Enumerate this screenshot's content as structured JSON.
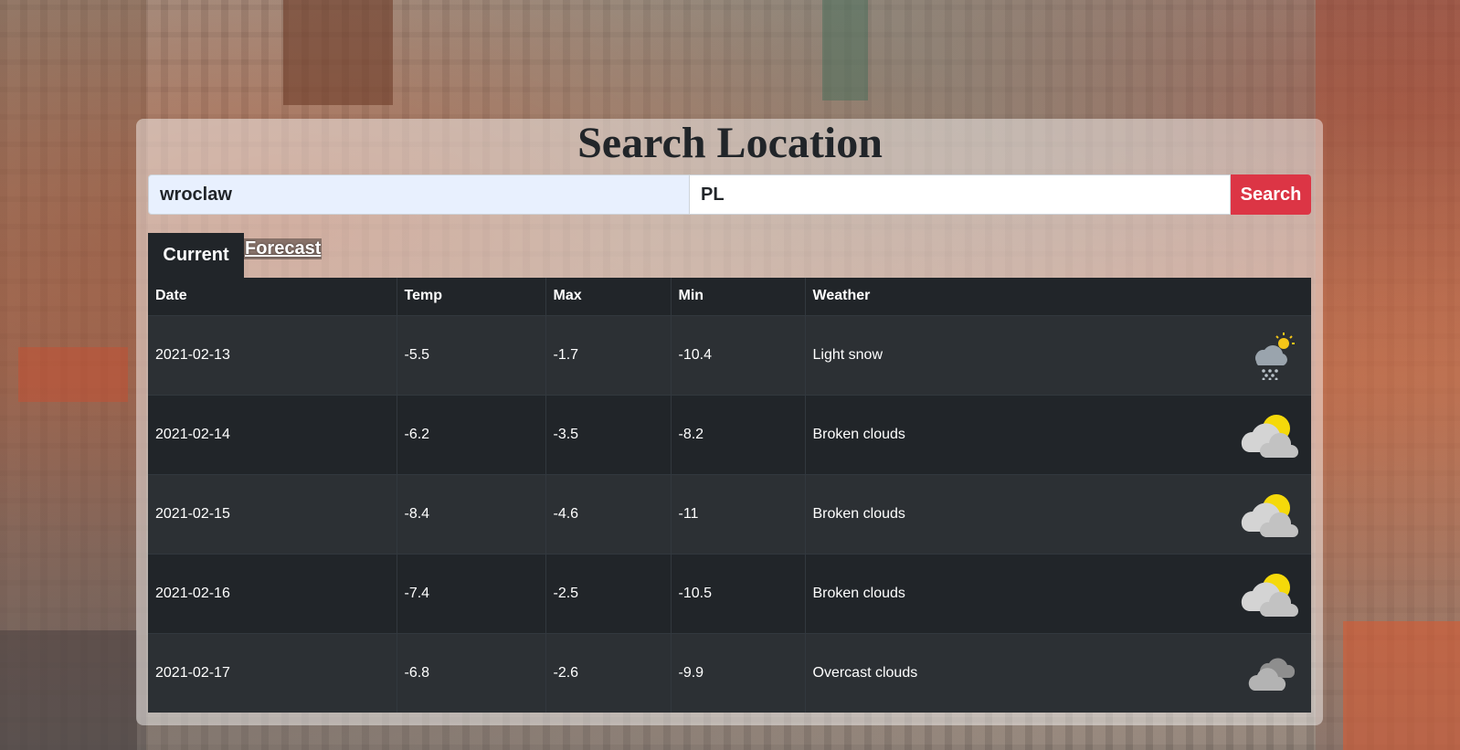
{
  "header": {
    "title": "Search Location"
  },
  "search": {
    "city_value": "wroclaw",
    "country_value": "PL",
    "button_label": "Search"
  },
  "tabs": [
    {
      "label": "Current",
      "active": true
    },
    {
      "label": "Forecast",
      "active": false
    }
  ],
  "table": {
    "columns": [
      "Date",
      "Temp",
      "Max",
      "Min",
      "Weather"
    ],
    "rows": [
      {
        "date": "2021-02-13",
        "temp": "-5.5",
        "max": "-1.7",
        "min": "-10.4",
        "weather": "Light snow",
        "icon": "light-snow-icon"
      },
      {
        "date": "2021-02-14",
        "temp": "-6.2",
        "max": "-3.5",
        "min": "-8.2",
        "weather": "Broken clouds",
        "icon": "broken-clouds-icon"
      },
      {
        "date": "2021-02-15",
        "temp": "-8.4",
        "max": "-4.6",
        "min": "-11",
        "weather": "Broken clouds",
        "icon": "broken-clouds-icon"
      },
      {
        "date": "2021-02-16",
        "temp": "-7.4",
        "max": "-2.5",
        "min": "-10.5",
        "weather": "Broken clouds",
        "icon": "broken-clouds-icon"
      },
      {
        "date": "2021-02-17",
        "temp": "-6.8",
        "max": "-2.6",
        "min": "-9.9",
        "weather": "Overcast clouds",
        "icon": "overcast-clouds-icon"
      }
    ]
  },
  "colors": {
    "accent": "#dc3545",
    "table_dark": "#212529",
    "table_stripe": "#2c3034"
  }
}
